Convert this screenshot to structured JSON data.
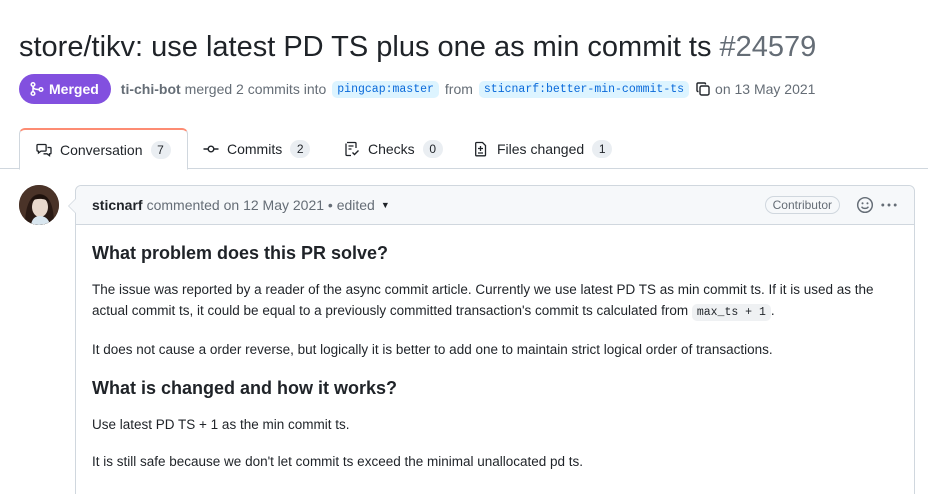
{
  "pr": {
    "title": "store/tikv: use latest PD TS plus one as min commit ts",
    "number": "#24579"
  },
  "meta": {
    "state": "Merged",
    "user": "ti-chi-bot",
    "merged_text": "merged 2 commits into",
    "base_branch": "pingcap:master",
    "from_text": "from",
    "head_branch": "sticnarf:better-min-commit-ts",
    "date_text": "on 13 May 2021"
  },
  "tabs": [
    {
      "label": "Conversation",
      "count": "7",
      "icon": "comment-discussion-icon"
    },
    {
      "label": "Commits",
      "count": "2",
      "icon": "git-commit-icon"
    },
    {
      "label": "Checks",
      "count": "0",
      "icon": "checklist-icon"
    },
    {
      "label": "Files changed",
      "count": "1",
      "icon": "file-diff-icon"
    }
  ],
  "comment": {
    "author": "sticnarf",
    "action": "commented on 12 May 2021 • edited",
    "role": "Contributor",
    "body": {
      "h1": "What problem does this PR solve?",
      "p1_a": "The issue was reported by a reader of the async commit article. Currently we use latest PD TS as min commit ts. If it is used as the actual commit ts, it could be equal to a previously committed transaction's commit ts calculated from",
      "p1_code": "max_ts + 1",
      "p1_b": ".",
      "p2": "It does not cause a order reverse, but logically it is better to add one to maintain strict logical order of transactions.",
      "h2": "What is changed and how it works?",
      "p3": "Use latest PD TS + 1 as the min commit ts.",
      "p4": "It is still safe because we don't let commit ts exceed the minimal unallocated pd ts."
    }
  },
  "colors": {
    "merged": "#8250df",
    "link": "#0969da",
    "branch_bg": "#ddf4ff",
    "active_tab_border": "#fd8c73"
  }
}
